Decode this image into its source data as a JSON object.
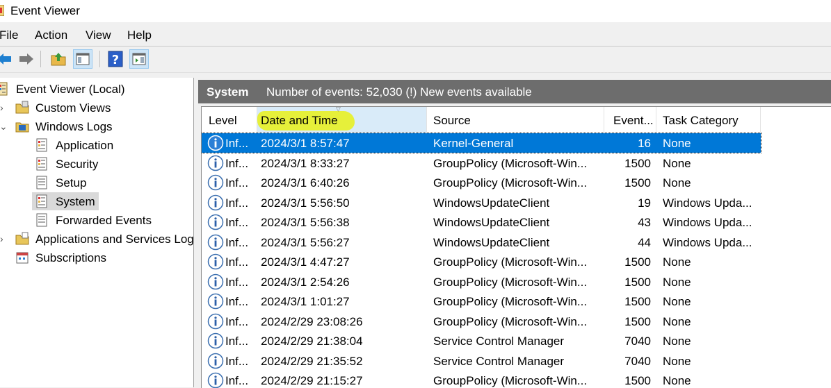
{
  "window": {
    "title": "Event Viewer"
  },
  "menu": [
    "File",
    "Action",
    "View",
    "Help"
  ],
  "toolbar": {
    "buttons": [
      "back-icon",
      "forward-icon",
      "up-folder-icon",
      "show-hide-tree-icon",
      "help-icon",
      "show-hide-action-pane-icon"
    ]
  },
  "tree": {
    "root": "Event Viewer (Local)",
    "custom_views": "Custom Views",
    "windows_logs": "Windows Logs",
    "application": "Application",
    "security": "Security",
    "setup": "Setup",
    "system": "System",
    "forwarded_events": "Forwarded Events",
    "apps_services": "Applications and Services Log",
    "subscriptions": "Subscriptions"
  },
  "log_header": {
    "name": "System",
    "info": "Number of events: 52,030 (!) New events available"
  },
  "columns": {
    "level": "Level",
    "datetime": "Date and Time",
    "source": "Source",
    "event_id": "Event...",
    "task_category": "Task Category"
  },
  "events": [
    {
      "level": "Inf...",
      "datetime": "2024/3/1 8:57:47",
      "source": "Kernel-General",
      "event_id": "16",
      "task_category": "None"
    },
    {
      "level": "Inf...",
      "datetime": "2024/3/1 8:33:27",
      "source": "GroupPolicy (Microsoft-Win...",
      "event_id": "1500",
      "task_category": "None"
    },
    {
      "level": "Inf...",
      "datetime": "2024/3/1 6:40:26",
      "source": "GroupPolicy (Microsoft-Win...",
      "event_id": "1500",
      "task_category": "None"
    },
    {
      "level": "Inf...",
      "datetime": "2024/3/1 5:56:50",
      "source": "WindowsUpdateClient",
      "event_id": "19",
      "task_category": "Windows Upda..."
    },
    {
      "level": "Inf...",
      "datetime": "2024/3/1 5:56:38",
      "source": "WindowsUpdateClient",
      "event_id": "43",
      "task_category": "Windows Upda..."
    },
    {
      "level": "Inf...",
      "datetime": "2024/3/1 5:56:27",
      "source": "WindowsUpdateClient",
      "event_id": "44",
      "task_category": "Windows Upda..."
    },
    {
      "level": "Inf...",
      "datetime": "2024/3/1 4:47:27",
      "source": "GroupPolicy (Microsoft-Win...",
      "event_id": "1500",
      "task_category": "None"
    },
    {
      "level": "Inf...",
      "datetime": "2024/3/1 2:54:26",
      "source": "GroupPolicy (Microsoft-Win...",
      "event_id": "1500",
      "task_category": "None"
    },
    {
      "level": "Inf...",
      "datetime": "2024/3/1 1:01:27",
      "source": "GroupPolicy (Microsoft-Win...",
      "event_id": "1500",
      "task_category": "None"
    },
    {
      "level": "Inf...",
      "datetime": "2024/2/29 23:08:26",
      "source": "GroupPolicy (Microsoft-Win...",
      "event_id": "1500",
      "task_category": "None"
    },
    {
      "level": "Inf...",
      "datetime": "2024/2/29 21:38:04",
      "source": "Service Control Manager",
      "event_id": "7040",
      "task_category": "None"
    },
    {
      "level": "Inf...",
      "datetime": "2024/2/29 21:35:52",
      "source": "Service Control Manager",
      "event_id": "7040",
      "task_category": "None"
    },
    {
      "level": "Inf...",
      "datetime": "2024/2/29 21:15:27",
      "source": "GroupPolicy (Microsoft-Win...",
      "event_id": "1500",
      "task_category": "None"
    }
  ],
  "colors": {
    "selection": "#0078d7",
    "header_bar": "#6d6d6d",
    "highlight": "#e6f03a",
    "sorted_column": "#d9ebf9"
  }
}
